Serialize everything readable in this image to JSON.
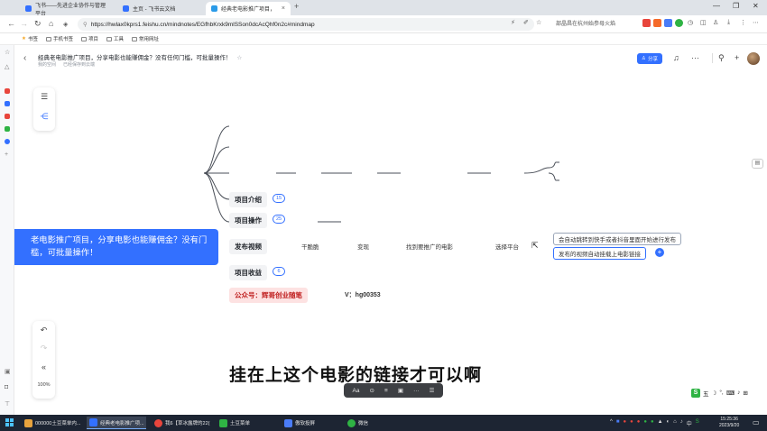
{
  "browser": {
    "tabs": [
      {
        "label": "飞书——先进企业协作与管理平台",
        "active": false
      },
      {
        "label": "主页 - 飞书云文档",
        "active": false
      },
      {
        "label": "经典老电影推广项目，分享电影...",
        "active": true
      }
    ],
    "url": "https://hwlax0kprs1.feishu.cn/mindnotes/EGfhbKrxk9mlSSon0dcAcQhf0n2c#mindmap",
    "right_extension_label": "部晶昌在杭州始参母火焰"
  },
  "bookmarks": [
    "书签",
    "手机书签",
    "项目",
    "工具",
    "常用网址"
  ],
  "doc": {
    "title": "经典老电影推广项目，分享电影也能赚佣金？没有任何门槛，可批量操作！",
    "location": "我的空间",
    "status": "已经保存到云端",
    "share_label": "分享",
    "accent": "#3370ff"
  },
  "mindmap": {
    "root": "老电影推广项目，分享电影也能赚佣金？没有门槛，可批量操作！",
    "branches": [
      {
        "label": "项目介绍",
        "count": "15"
      },
      {
        "label": "项目操作",
        "count": "25"
      },
      {
        "label": "发布视频",
        "count": null
      },
      {
        "label": "项目收益",
        "count": "6"
      },
      {
        "label": "公众号：辉哥创业随笔",
        "count": null
      }
    ],
    "chain": [
      "干脆脆",
      "变现",
      "找到要推广的电影",
      "选择平台"
    ],
    "options": [
      "会自动跳转到快手或者抖音里面开始进行发布",
      "发布的视频自动挂载上电影链接"
    ],
    "wechat": "V：hg00353"
  },
  "zoom": "100%",
  "subtitle": "挂在上这个电影的链接才可以啊",
  "float_toolbar": [
    "Aa",
    "⊙",
    "≡",
    "▣",
    "···",
    "☰"
  ],
  "ime_label": "五",
  "taskbar": {
    "apps": [
      {
        "label": "000000土豆菜单内...",
        "color": "#e8a33d"
      },
      {
        "label": "经典老电影推广项...",
        "color": "#3370ff"
      },
      {
        "label": "我6【草冰露牌的22(...",
        "color": "#e8453c"
      },
      {
        "label": "土豆菜单",
        "color": "#2fb344"
      },
      {
        "label": "傲软投屏",
        "color": "#4a7cf7"
      },
      {
        "label": "微信",
        "color": "#2fb344"
      }
    ],
    "time": "15:25:36",
    "date": "2023/9/20",
    "tray_lang": "中"
  }
}
